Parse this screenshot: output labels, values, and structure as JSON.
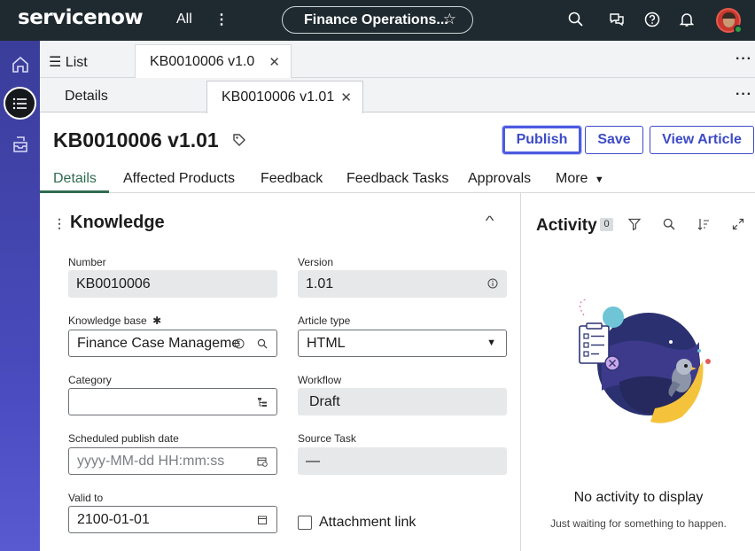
{
  "topnav": {
    "logo": "servicenow",
    "all_label": "All",
    "workspace_pill": "Finance Operations...",
    "colors": {
      "bar": "#1f2a30",
      "logo_accent": "#6fce68"
    },
    "icons": [
      "search-icon",
      "chat-icon",
      "help-icon",
      "bell-icon"
    ]
  },
  "rail": {
    "icons": [
      "home-icon",
      "list-icon",
      "inbox-icon"
    ],
    "color": "#3b3d9a"
  },
  "tabs_row1": {
    "list_label": "List",
    "tab_label": "KB0010006 v1.0",
    "close": "✕"
  },
  "tabs_row2": {
    "details_label": "Details",
    "tab_label": "KB0010006 v1.01",
    "close": "✕"
  },
  "record": {
    "title": "KB0010006 v1.01",
    "buttons": {
      "publish": "Publish",
      "save": "Save",
      "view_article": "View Article"
    },
    "accent": "#3d4bc7"
  },
  "form_tabs": {
    "items": [
      "Details",
      "Affected Products",
      "Feedback",
      "Feedback Tasks",
      "Approvals"
    ],
    "more": "More",
    "active_color": "#2f6b50"
  },
  "section": {
    "title": "Knowledge",
    "fields": {
      "number": {
        "label": "Number",
        "value": "KB0010006"
      },
      "version": {
        "label": "Version",
        "value": "1.01"
      },
      "knowledge_base": {
        "label": "Knowledge base",
        "required_mark": "✱",
        "value": "Finance Case Manageme"
      },
      "article_type": {
        "label": "Article type",
        "value": "HTML"
      },
      "category": {
        "label": "Category",
        "value": ""
      },
      "workflow": {
        "label": "Workflow",
        "value": "Draft"
      },
      "scheduled_publish_date": {
        "label": "Scheduled publish date",
        "placeholder": "yyyy-MM-dd HH:mm:ss"
      },
      "source_task": {
        "label": "Source Task",
        "value": "—"
      },
      "valid_to": {
        "label": "Valid to",
        "value": "2100-01-01"
      },
      "attachment_link": {
        "label": "Attachment link",
        "checked": false
      }
    }
  },
  "activity": {
    "title": "Activity",
    "count": "0",
    "empty_title": "No activity to display",
    "empty_subtitle": "Just waiting for something to happen."
  }
}
